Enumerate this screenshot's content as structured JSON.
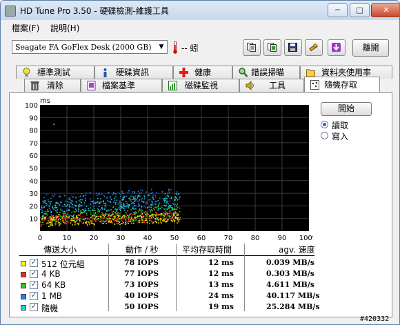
{
  "window": {
    "title": "HD Tune Pro 3.50 - 硬碟檢測-維護工具",
    "minimize": "─",
    "maximize": "□",
    "close": "✕"
  },
  "menu": {
    "items": [
      {
        "label": "檔案(F)"
      },
      {
        "label": "說明(H)"
      }
    ]
  },
  "toolbar": {
    "drive": "Seagate FA GoFlex Desk (2000 GB)",
    "temperature": "-- 蚓",
    "exit_label": "離開"
  },
  "tabs": {
    "row1": [
      {
        "label": "標準測試"
      },
      {
        "label": "硬碟資訊"
      },
      {
        "label": "健康"
      },
      {
        "label": "錯誤掃瞄"
      },
      {
        "label": "資料夾使用率"
      }
    ],
    "row2": [
      {
        "label": "清除"
      },
      {
        "label": "檔案基準"
      },
      {
        "label": "磁碟監視"
      },
      {
        "label": "工具"
      },
      {
        "label": "隨機存取"
      }
    ]
  },
  "controls": {
    "start_label": "開始",
    "read_label": "讀取",
    "write_label": "寫入",
    "selected": "read"
  },
  "chart_data": {
    "type": "scatter",
    "y_unit": "ms",
    "x_unit": "%",
    "x_ticks": [
      "0",
      "10",
      "20",
      "30",
      "40",
      "50",
      "60",
      "70",
      "80",
      "90",
      "100%"
    ],
    "y_ticks": [
      "100",
      "90",
      "80",
      "70",
      "60",
      "50",
      "40",
      "30",
      "20",
      "10"
    ],
    "xlim": [
      0,
      100
    ],
    "ylim": [
      0,
      100
    ],
    "grid": true,
    "series": [
      {
        "name": "512 位元組",
        "color": "#e8e800",
        "x_range": [
          0,
          52
        ],
        "y_center": 8,
        "y_spread": 5
      },
      {
        "name": "4 KB",
        "color": "#e52a20",
        "x_range": [
          0,
          52
        ],
        "y_center": 9,
        "y_spread": 5
      },
      {
        "name": "64 KB",
        "color": "#3ec02c",
        "x_range": [
          0,
          52
        ],
        "y_center": 11,
        "y_spread": 7
      },
      {
        "name": "1 MB",
        "color": "#2d7fe0",
        "x_range": [
          0,
          52
        ],
        "y_center": 22,
        "y_spread": 9
      },
      {
        "name": "隨機",
        "color": "#22d0d8",
        "x_range": [
          0,
          52
        ],
        "y_center": 18,
        "y_spread": 9
      }
    ]
  },
  "table": {
    "headers": {
      "size": "傳送大小",
      "ops": "動作 / 秒",
      "access": "平均存取時間",
      "speed": "agv. 速度"
    },
    "rows": [
      {
        "label": "512 位元組",
        "color": "#ffff00",
        "ops": "78 IOPS",
        "access": "12 ms",
        "speed": "0.039 MB/s"
      },
      {
        "label": "4 KB",
        "color": "#e52a20",
        "ops": "77 IOPS",
        "access": "12 ms",
        "speed": "0.303 MB/s"
      },
      {
        "label": "64 KB",
        "color": "#3ec02c",
        "ops": "73 IOPS",
        "access": "13 ms",
        "speed": "4.611 MB/s"
      },
      {
        "label": "1 MB",
        "color": "#2d7fe0",
        "ops": "40 IOPS",
        "access": "24 ms",
        "speed": "40.117 MB/s"
      },
      {
        "label": "隨機",
        "color": "#22d0d8",
        "ops": "50 IOPS",
        "access": "19 ms",
        "speed": "25.284 MB/s"
      }
    ]
  },
  "watermark": "#420332"
}
